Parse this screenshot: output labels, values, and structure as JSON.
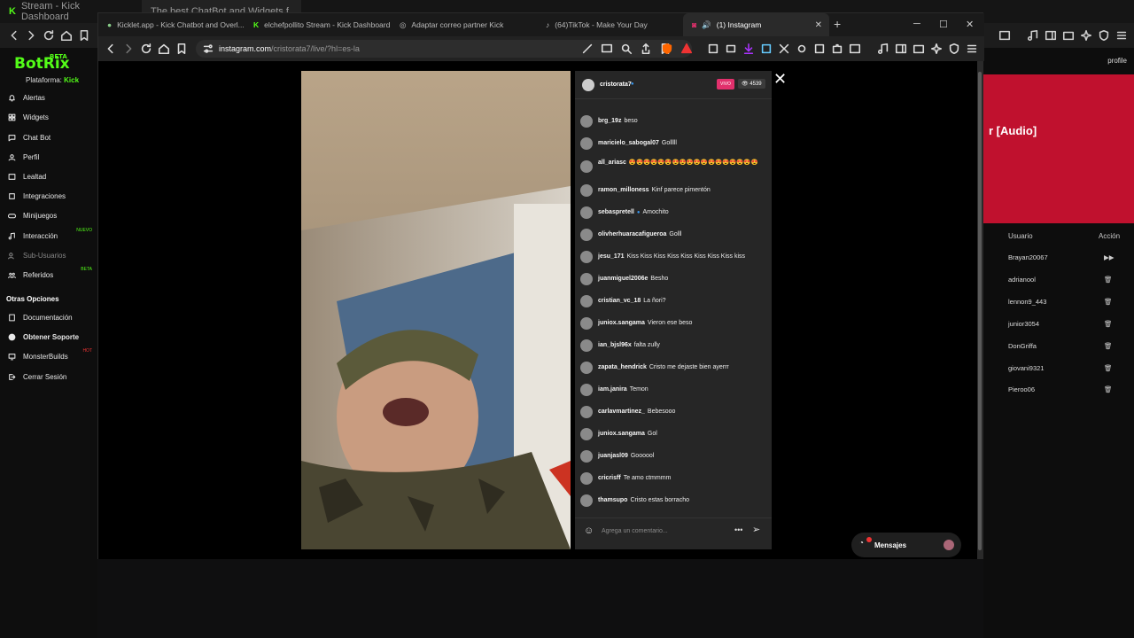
{
  "bg_tabs": [
    {
      "label": "Stream - Kick Dashboard"
    },
    {
      "label": "The best ChatBot and Widgets f..."
    }
  ],
  "sidebar": {
    "logo": "BotRix",
    "logo_badge": "BETA",
    "platform_label": "Plataforma:",
    "platform_value": "Kick",
    "items": [
      {
        "label": "Alertas",
        "icon": "bell-icon"
      },
      {
        "label": "Widgets",
        "icon": "grid-icon"
      },
      {
        "label": "Chat Bot",
        "icon": "chat-icon"
      },
      {
        "label": "Perfil",
        "icon": "user-icon"
      },
      {
        "label": "Lealtad",
        "icon": "loyalty-icon"
      },
      {
        "label": "Integraciones",
        "icon": "plug-icon"
      },
      {
        "label": "Minijuegos",
        "icon": "gamepad-icon"
      },
      {
        "label": "Interacción",
        "icon": "music-icon",
        "badge": "NUEVO"
      },
      {
        "label": "Sub-Usuarios",
        "icon": "users-icon"
      },
      {
        "label": "Referidos",
        "icon": "referral-icon",
        "badge": "BETA"
      }
    ],
    "other_title": "Otras Opciones",
    "other_items": [
      {
        "label": "Documentación",
        "icon": "doc-icon"
      },
      {
        "label": "Obtener Soporte",
        "icon": "support-icon"
      },
      {
        "label": "MonsterBuilds",
        "icon": "monitor-icon",
        "badge": "HOT"
      },
      {
        "label": "Cerrar Sesión",
        "icon": "logout-icon"
      }
    ]
  },
  "right_panel": {
    "profile_link": "profile",
    "banner_text": "r [Audio]",
    "col_user": "Usuario",
    "col_action": "Acción",
    "rows": [
      {
        "user": "Brayan20067"
      },
      {
        "user": "adrianool"
      },
      {
        "user": "lennon9_443"
      },
      {
        "user": "junior3054"
      },
      {
        "user": "DonGriffa"
      },
      {
        "user": "giovani9321"
      },
      {
        "user": "Pieroo06"
      }
    ]
  },
  "tabs": [
    {
      "label": "Kicklet.app - Kick Chatbot and Overl..."
    },
    {
      "label": "elchefpollito Stream - Kick Dashboard"
    },
    {
      "label": "Adaptar correo partner Kick"
    },
    {
      "label": "(64)TikTok - Make Your Day"
    },
    {
      "label": "(1) Instagram"
    }
  ],
  "url": {
    "host": "instagram.com",
    "path": "/cristorata7/live/?hl=es-la"
  },
  "live": {
    "host": "cristorata7",
    "live_badge": "VIVO",
    "viewers": "4539",
    "comments": [
      {
        "user": "brg_19z",
        "text": "beso"
      },
      {
        "user": "maricielo_sabogal07",
        "text": "Golllll"
      },
      {
        "user": "all_ariasc",
        "text": "😍😍😍😍😍😍😍😍😍😍😍😍😍😍😍😍😍😍"
      },
      {
        "user": "ramon_milloness",
        "text": "Kinf parece pimentón"
      },
      {
        "user": "sebaspretell",
        "text": "Amochito"
      },
      {
        "user": "olivherhuaracafigueroa",
        "text": "Golll"
      },
      {
        "user": "jesu_171",
        "text": "Kiss Kiss Kiss Kiss Kiss Kiss Kiss Kiss kiss"
      },
      {
        "user": "juanmiguel2006e",
        "text": "Besho"
      },
      {
        "user": "cristian_vc_18",
        "text": "La ñori?"
      },
      {
        "user": "juniox.sangama",
        "text": "Vieron ese beso"
      },
      {
        "user": "ian_bjsl96x",
        "text": "falta zully"
      },
      {
        "user": "zapata_hendrick",
        "text": "Cristo me dejaste bien ayerrr"
      },
      {
        "user": "iam.janira",
        "text": "Temon"
      },
      {
        "user": "carlavmartinez_",
        "text": "Bebesooo"
      },
      {
        "user": "juniox.sangama",
        "text": "Gol"
      },
      {
        "user": "juanjasl09",
        "text": "Goooool"
      },
      {
        "user": "cricrisff",
        "text": "Te amo ctmmmm"
      },
      {
        "user": "thamsupo",
        "text": "Cristo estas borracho"
      }
    ],
    "input_placeholder": "Agrega un comentario...",
    "messages_label": "Mensajes"
  }
}
